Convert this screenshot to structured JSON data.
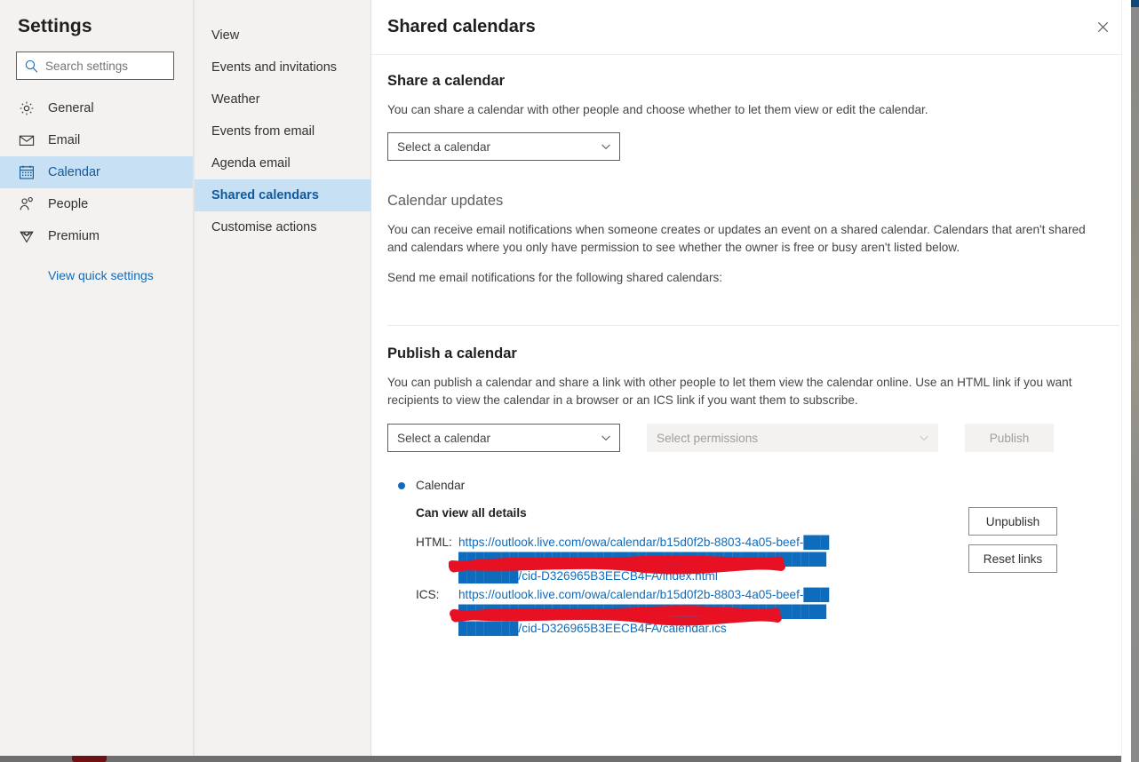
{
  "sidebar": {
    "title": "Settings",
    "search": {
      "placeholder": "Search settings",
      "value": "",
      "icon": "search-icon"
    },
    "items": [
      {
        "label": "General",
        "icon": "gear-icon",
        "selected": false
      },
      {
        "label": "Email",
        "icon": "envelope-icon",
        "selected": false
      },
      {
        "label": "Calendar",
        "icon": "calendar-icon",
        "selected": true
      },
      {
        "label": "People",
        "icon": "people-icon",
        "selected": false
      },
      {
        "label": "Premium",
        "icon": "diamond-icon",
        "selected": false
      }
    ],
    "quick_settings_link": "View quick settings"
  },
  "subnav": {
    "items": [
      {
        "label": "View",
        "selected": false
      },
      {
        "label": "Events and invitations",
        "selected": false
      },
      {
        "label": "Weather",
        "selected": false
      },
      {
        "label": "Events from email",
        "selected": false
      },
      {
        "label": "Agenda email",
        "selected": false
      },
      {
        "label": "Shared calendars",
        "selected": true
      },
      {
        "label": "Customise actions",
        "selected": false
      }
    ]
  },
  "detail": {
    "title": "Shared calendars",
    "close_icon": "close-icon",
    "share_section": {
      "heading": "Share a calendar",
      "description": "You can share a calendar with other people and choose whether to let them view or edit the calendar.",
      "calendar_select": {
        "value": "Select a calendar",
        "chevron_icon": "chevron-down-icon"
      }
    },
    "updates_section": {
      "heading": "Calendar updates",
      "description": "You can receive email notifications when someone creates or updates an event on a shared calendar. Calendars that aren't shared and calendars where you only have permission to see whether the owner is free or busy aren't listed below.",
      "subtext": "Send me email notifications for the following shared calendars:"
    },
    "publish_section": {
      "heading": "Publish a calendar",
      "description": "You can publish a calendar and share a link with other people to let them view the calendar online. Use an HTML link if you want recipients to view the calendar in a browser or an ICS link if you want them to subscribe.",
      "calendar_select": {
        "value": "Select a calendar",
        "chevron_icon": "chevron-down-icon"
      },
      "permissions_select": {
        "value": "Select permissions",
        "chevron_icon": "chevron-down-icon",
        "disabled": true
      },
      "publish_button": {
        "label": "Publish",
        "disabled": true
      },
      "published_calendar": {
        "name": "Calendar",
        "permission": "Can view all details",
        "links": [
          {
            "key": "HTML:",
            "value": "https://outlook.live.com/owa/calendar/b15d0f2b-8803-4a05-beef-█████████████████████████████████████████████████████/cid-D326965B3EECB4FA/index.html"
          },
          {
            "key": "ICS:",
            "value": "https://outlook.live.com/owa/calendar/b15d0f2b-8803-4a05-beef-█████████████████████████████████████████████████████/cid-D326965B3EECB4FA/calendar.ics"
          }
        ],
        "unpublish_button": "Unpublish",
        "reset_links_button": "Reset links"
      }
    }
  },
  "colors": {
    "accent": "#0f6cbd",
    "selected_bg": "#c7e0f4",
    "selected_text": "#13599d",
    "panel_bg": "#f3f2f1",
    "redaction": "#e81123",
    "text_primary": "#201f1e",
    "text_secondary": "#484644",
    "disabled_text": "#a19f9d"
  }
}
